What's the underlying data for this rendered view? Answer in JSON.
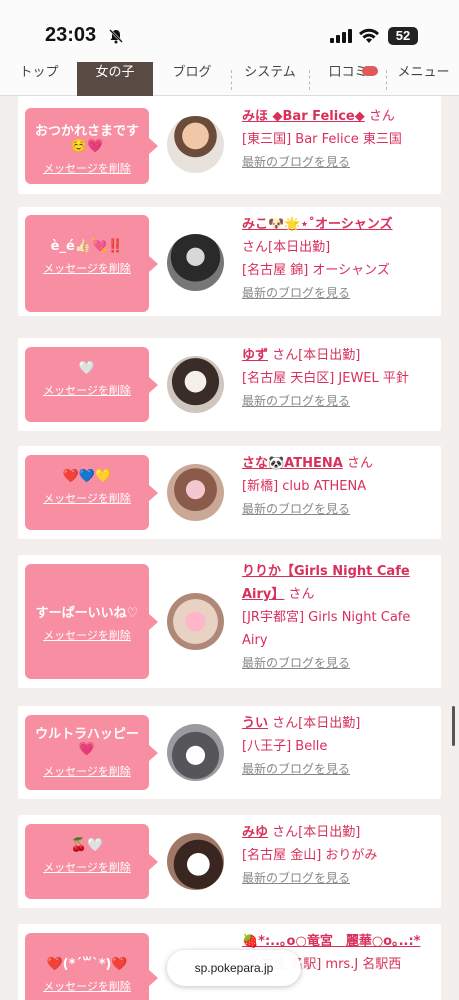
{
  "status": {
    "time": "23:03",
    "battery": "52"
  },
  "tabs": [
    "トップ",
    "女の子",
    "ブログ",
    "システム",
    "口コミ",
    "メニュー"
  ],
  "url": "sp.pokepara.jp",
  "delete_label": "メッセージを削除",
  "blog_label": "最新のブログを見る",
  "cards": [
    {
      "message": "おつかれさまです☺️💗",
      "name": "みほ ◆Bar Felice◆",
      "suffix": "さん",
      "store": "[東三国] Bar Felice 東三国"
    },
    {
      "message": "è_é👍🏻💘‼️",
      "name": "みこ🐶🌟⋆˚オーシャンズ",
      "suffix": "さん[本日出勤]",
      "store": "[名古屋 錦] オーシャンズ"
    },
    {
      "message": "🤍",
      "name": "ゆず",
      "suffix": "さん[本日出勤]",
      "store": "[名古屋 天白区] JEWEL 平針"
    },
    {
      "message": "❤️💙💛",
      "name": "さな🐼ATHENA",
      "suffix": "さん",
      "store": "[新橋] club ATHENA"
    },
    {
      "message": "すーぱーいいね♡",
      "name": "りりか【Girls Night Cafe Airy】",
      "suffix": "さん",
      "store": "[JR宇都宮] Girls Night Cafe Airy"
    },
    {
      "message": "ウルトラハッピー💗",
      "name": "うい",
      "suffix": "さん[本日出勤]",
      "store": "[八王子] Belle"
    },
    {
      "message": "🍒🤍",
      "name": "みゆ",
      "suffix": "さん[本日出勤]",
      "store": "[名古屋 金山] おりがみ"
    },
    {
      "message": "❤️(*´꒳`*)❤️",
      "name": "🍓*:..｡o○竜宮　麗華○o｡..:*",
      "suffix": "",
      "store": "[名古屋 名駅] mrs.J 名駅西"
    }
  ]
}
